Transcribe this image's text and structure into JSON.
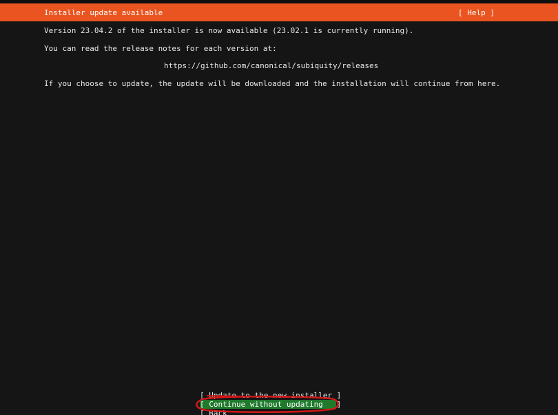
{
  "header": {
    "title": "Installer update available",
    "help_label": "[ Help ]",
    "color": "#e95420"
  },
  "body": {
    "line_version": "Version 23.04.2 of the installer is now available (23.02.1 is currently running).",
    "line_notes": "You can read the release notes for each version at:",
    "url": "https://github.com/canonical/subiquity/releases",
    "line_update": "If you choose to update, the update will be downloaded and the installation will continue from here."
  },
  "buttons": {
    "update": "[ Update to the new installer ]",
    "continue": "[ Continue without updating   ]",
    "back": "[ Back                        ]"
  },
  "colors": {
    "background": "#151515",
    "selected_button": "#1f7a2c",
    "annotation": "#d01818"
  }
}
